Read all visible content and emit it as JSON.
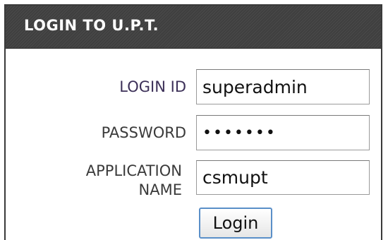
{
  "header": {
    "title": "LOGIN TO U.P.T."
  },
  "form": {
    "login_id_label": "LOGIN ID",
    "login_id_value": "superadmin",
    "password_label": "PASSWORD",
    "password_value": "•••••••",
    "application_name_label_line1": "APPLICATION",
    "application_name_label_line2": "NAME",
    "application_name_value": "csmupt",
    "login_button_label": "Login"
  },
  "colors": {
    "header_background": "#444444",
    "header_text": "#ffffff",
    "button_border": "#5a8fc8"
  }
}
